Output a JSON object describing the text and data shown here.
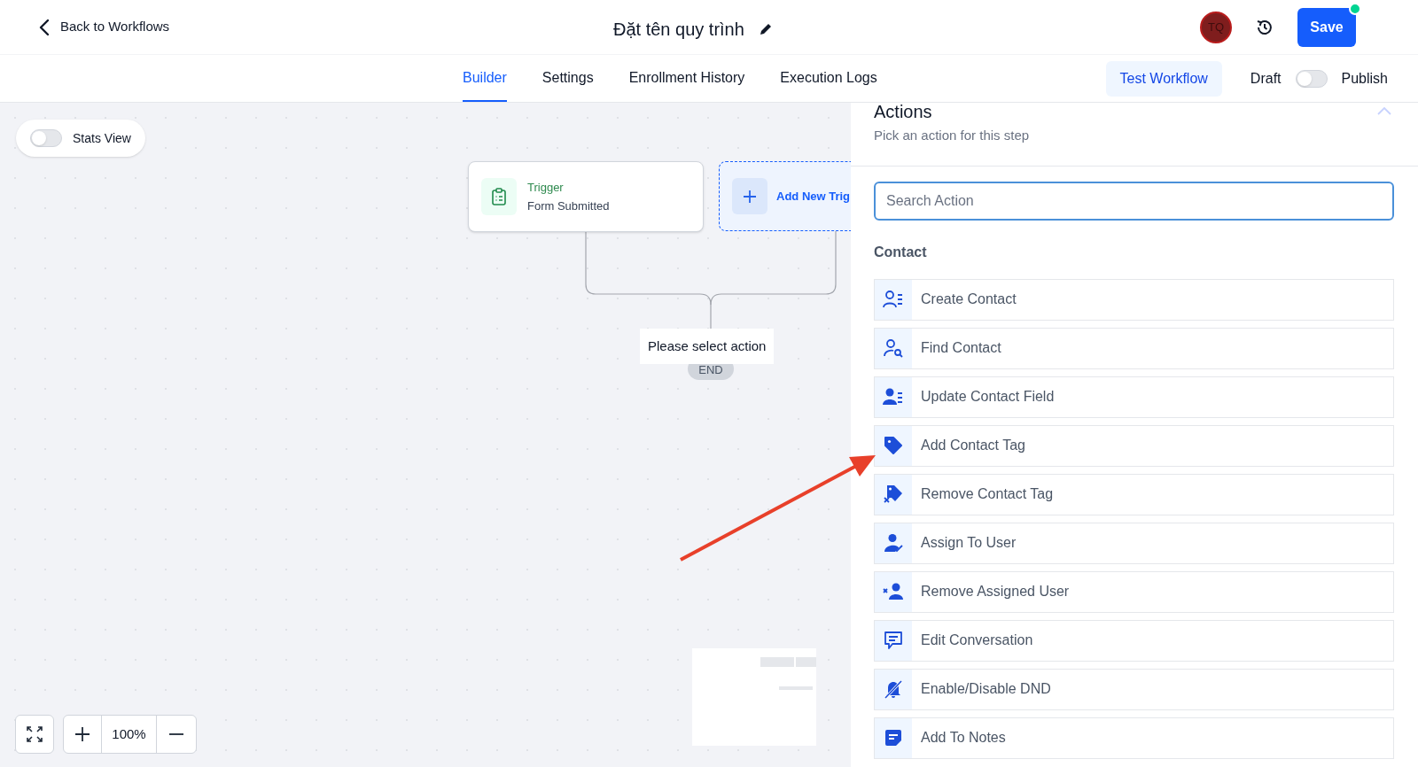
{
  "header": {
    "back_link": "Back to Workflows",
    "title": "Đặt tên quy trình",
    "avatar": "TQ",
    "save_button": "Save"
  },
  "tabs": [
    {
      "label": "Builder",
      "selected": true
    },
    {
      "label": "Settings",
      "selected": false
    },
    {
      "label": "Enrollment History",
      "selected": false
    },
    {
      "label": "Execution Logs",
      "selected": false
    }
  ],
  "test_button": "Test Workflow",
  "status_toggle": {
    "left_label": "Draft",
    "right_label": "Publish",
    "on": false
  },
  "canvas": {
    "stats_view": {
      "label": "Stats View",
      "on": false
    },
    "trigger_card": {
      "label": "Trigger",
      "value": "Form Submitted"
    },
    "add_trigger_card": {
      "label": "Add New Trig"
    },
    "action_placeholder": "Please select action",
    "end_label": "END",
    "zoom_level": "100%"
  },
  "panel": {
    "title": "Actions",
    "subtitle": "Pick an action for this step",
    "search": {
      "placeholder": "Search Action"
    },
    "section": "Contact",
    "actions": [
      {
        "label": "Create Contact"
      },
      {
        "label": "Find Contact"
      },
      {
        "label": "Update Contact Field"
      },
      {
        "label": "Add Contact Tag"
      },
      {
        "label": "Remove Contact Tag"
      },
      {
        "label": "Assign To User"
      },
      {
        "label": "Remove Assigned User"
      },
      {
        "label": "Edit Conversation"
      },
      {
        "label": "Enable/Disable DND"
      },
      {
        "label": "Add To Notes"
      }
    ]
  }
}
